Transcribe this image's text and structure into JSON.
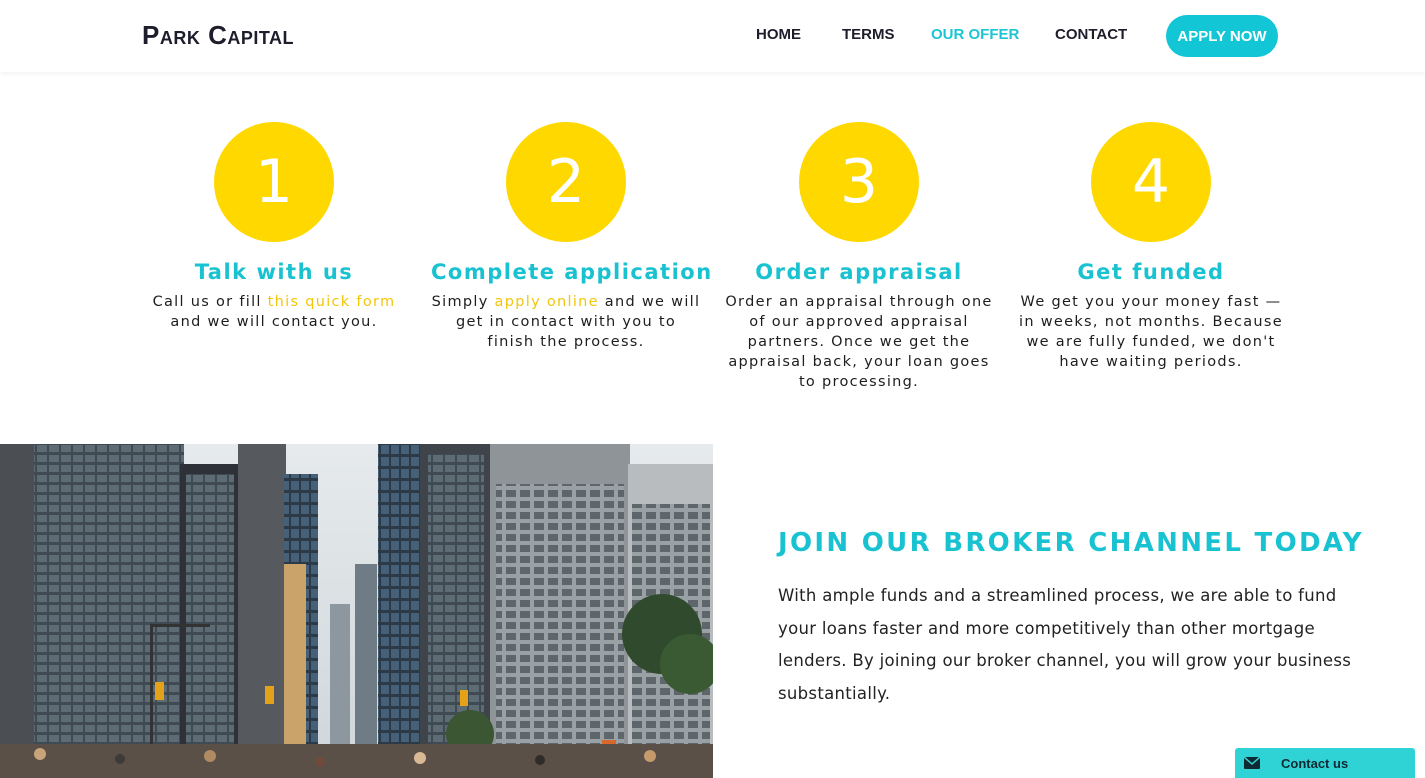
{
  "header": {
    "logo": "Park Capital",
    "nav": [
      {
        "label": "HOME",
        "active": false
      },
      {
        "label": "TERMS",
        "active": false
      },
      {
        "label": "OUR OFFER",
        "active": true
      },
      {
        "label": "CONTACT",
        "active": false
      }
    ],
    "apply_label": "APPLY NOW"
  },
  "steps": [
    {
      "number": "1",
      "title": "Talk with us",
      "desc_pre": "Call us or fill ",
      "desc_link": "this quick form",
      "desc_post": " and we will contact you."
    },
    {
      "number": "2",
      "title": "Complete application",
      "desc_pre": "Simply ",
      "desc_link": "apply online",
      "desc_post": " and we will get in contact with you to finish the process."
    },
    {
      "number": "3",
      "title": "Order appraisal",
      "desc": "Order an appraisal through one of our approved appraisal partners. Once we get the appraisal back, your loan goes to processing."
    },
    {
      "number": "4",
      "title": "Get funded",
      "desc": "We get you your money fast — in weeks, not months. Because we are fully funded, we don't have waiting periods."
    }
  ],
  "broker": {
    "title": "JOIN OUR BROKER CHANNEL TODAY",
    "text": "With ample funds and a streamlined process, we are able to fund your loans faster and more competitively than other mortgage lenders. By joining our broker channel, you will grow your business substantially."
  },
  "contact_widget": {
    "label": "Contact us",
    "icon": "envelope-icon"
  },
  "colors": {
    "accent": "#19c2d0",
    "yellow": "#ffd800",
    "link_yellow": "#f2c60a",
    "dark": "#1d1d2b"
  }
}
